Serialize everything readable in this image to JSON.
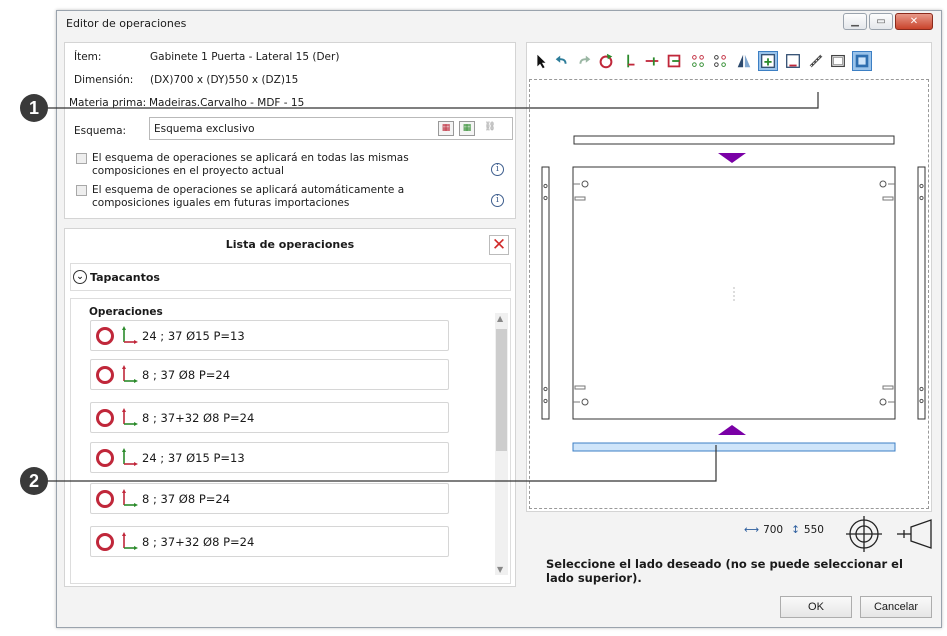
{
  "window": {
    "title": "Editor de operaciones"
  },
  "info": {
    "item_label": "Ítem:",
    "item_value": "Gabinete 1 Puerta - Lateral 15 (Der)",
    "dim_label": "Dimensión:",
    "dim_value": "(DX)700 x (DY)550 x (DZ)15",
    "mat_label": "Materia prima:",
    "mat_value": "Madeiras.Carvalho - MDF - 15",
    "schema_label": "Esquema:",
    "schema_value": "Esquema exclusivo",
    "check1": "El esquema de operaciones se aplicará en todas las mismas composiciones en el proyecto actual",
    "check2": "El esquema de operaciones se aplicará automáticamente a composiciones iguales em futuras importaciones"
  },
  "ops": {
    "title": "Lista de operaciones",
    "group": "Tapacantos",
    "list_title": "Operaciones",
    "items": [
      "24 ; 37 Ø15 P=13",
      "8 ; 37 Ø8 P=24",
      "8 ; 37+32 Ø8 P=24",
      "24 ; 37 Ø15 P=13",
      "8 ; 37 Ø8 P=24",
      "8 ; 37+32 Ø8 P=24"
    ]
  },
  "preview": {
    "width_value": "700",
    "height_value": "550"
  },
  "hint": "Seleccione el lado deseado (no se puede seleccionar el lado superior).",
  "buttons": {
    "ok": "OK",
    "cancel": "Cancelar"
  },
  "callouts": [
    "1",
    "2"
  ],
  "colors": {
    "accent": "#7a00a6",
    "ring": "#c0273a",
    "selected_side": "#9ac3ea"
  }
}
